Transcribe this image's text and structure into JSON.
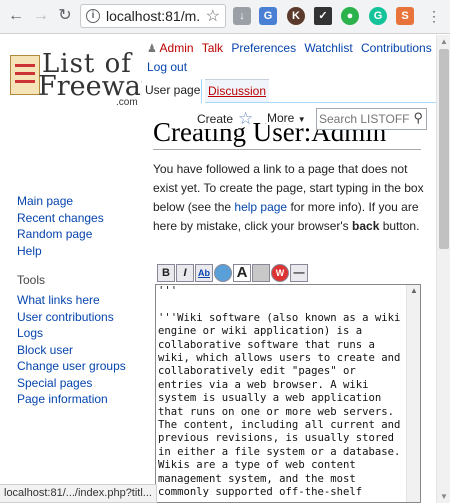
{
  "browser": {
    "url": "localhost:81/m...",
    "status_url": "localhost:81/.../index.php?titl..."
  },
  "site": {
    "logo_line1": "List of",
    "logo_line2": "Freeware",
    "logo_line3": ".com"
  },
  "personal_tools": {
    "username": "Admin",
    "talk": "Talk",
    "preferences": "Preferences",
    "watchlist": "Watchlist",
    "contributions": "Contributions",
    "logout": "Log out"
  },
  "tabs": {
    "user_page": "User page",
    "discussion": "Discussion",
    "create": "Create",
    "more": "More"
  },
  "search": {
    "placeholder": "Search LISTOFF"
  },
  "sidebar": {
    "nav": [
      "Main page",
      "Recent changes",
      "Random page",
      "Help"
    ],
    "tools_heading": "Tools",
    "tools": [
      "What links here",
      "User contributions",
      "Logs",
      "Block user",
      "Change user groups",
      "Special pages",
      "Page information"
    ]
  },
  "page": {
    "title": "Creating User:Admin",
    "intro_before": "You have followed a link to a page that does not exist yet. To create the page, start typing in the box below (see the ",
    "help_link": "help page",
    "intro_middle": " for more info). If you are here by mistake, click your browser's ",
    "back_word": "back",
    "intro_after": " button."
  },
  "toolbar": {
    "bold": "B",
    "italic": "I",
    "link": "Ab",
    "image": "A"
  },
  "editor": {
    "content": "'''\n\n'''Wiki software (also known as a wiki\nengine or wiki application) is a\ncollaborative software that runs a\nwiki, which allows users to create and\ncollaboratively edit \"pages\" or\nentries via a web browser. A wiki\nsystem is usually a web application\nthat runs on one or more web servers.\nThe content, including all current and\nprevious revisions, is usually stored\nin either a file system or a database.\nWikis are a type of web content\nmanagement system, and the most\ncommonly supported off-the-shelf"
  },
  "icons": {
    "back": "arrow-left-icon",
    "forward": "arrow-right-icon",
    "reload": "reload-icon",
    "info": "info-icon",
    "bookmark": "star-icon",
    "user": "user-icon",
    "watch": "star-outline-icon",
    "search": "magnifier-icon"
  },
  "colors": {
    "link": "#0645ad",
    "new_link": "#ba0000",
    "tab_border": "#a7d7f9"
  }
}
